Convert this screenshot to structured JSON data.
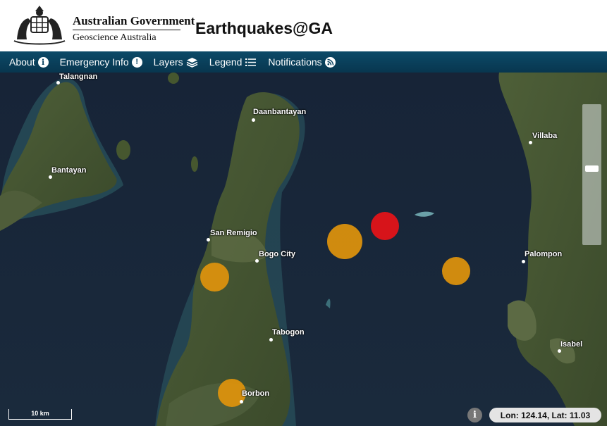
{
  "header": {
    "gov_title": "Australian Government",
    "gov_subtitle": "Geoscience Australia",
    "app_title": "Earthquakes@GA"
  },
  "nav": [
    {
      "label": "About",
      "icon": "info-icon"
    },
    {
      "label": "Emergency Info",
      "icon": "alert-icon"
    },
    {
      "label": "Layers",
      "icon": "layers-icon"
    },
    {
      "label": "Legend",
      "icon": "legend-list-icon"
    },
    {
      "label": "Notifications",
      "icon": "rss-icon"
    }
  ],
  "places": [
    {
      "name": "Talangnan"
    },
    {
      "name": "Daanbantayan"
    },
    {
      "name": "Villaba"
    },
    {
      "name": "Bantayan"
    },
    {
      "name": "San Remigio"
    },
    {
      "name": "Bogo City"
    },
    {
      "name": "Palompon"
    },
    {
      "name": "Tabogon"
    },
    {
      "name": "Isabel"
    },
    {
      "name": "Borbon"
    }
  ],
  "quake_colors": {
    "recent": "#d7141a",
    "older": "#e0940c"
  },
  "scale": {
    "label": "10 km"
  },
  "status": {
    "info": "i",
    "coords": "Lon: 124.14, Lat: 11.03"
  }
}
